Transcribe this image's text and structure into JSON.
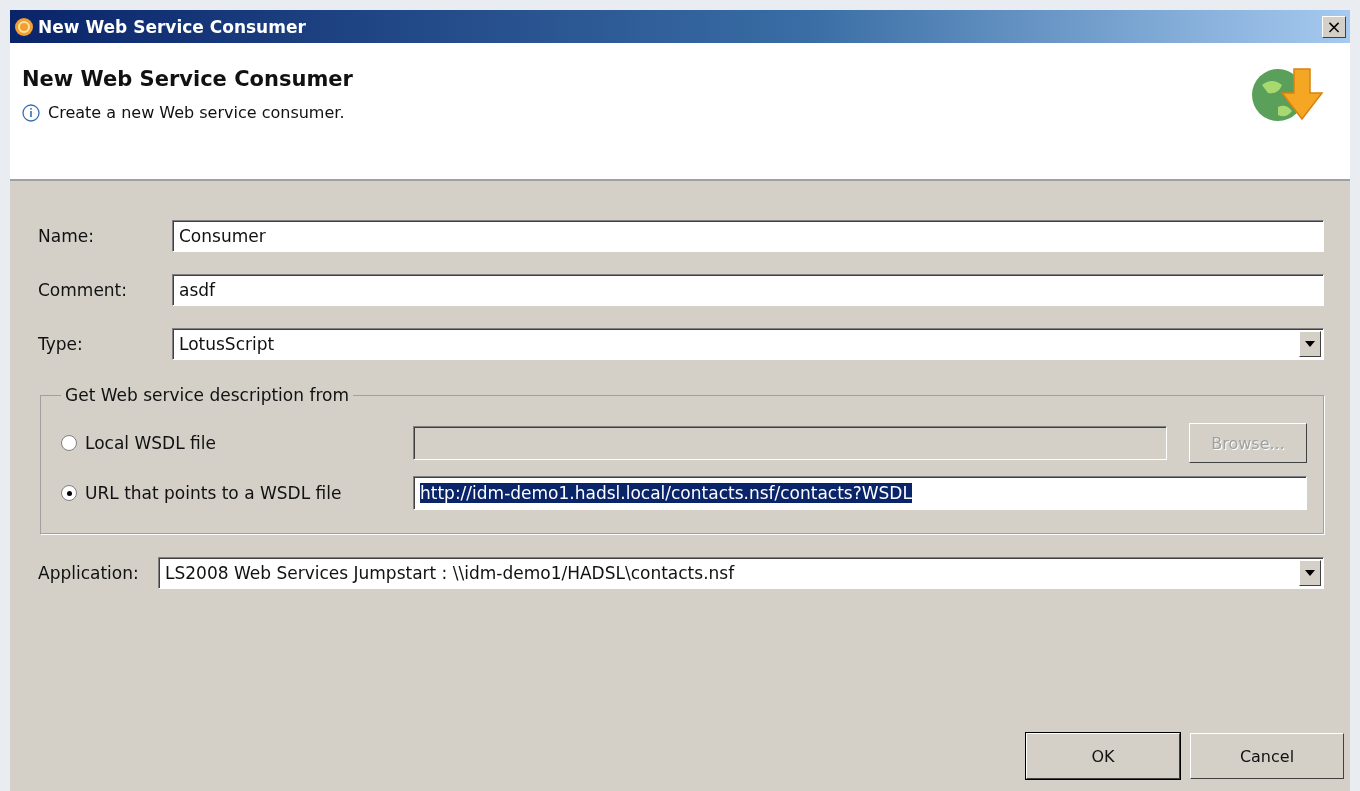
{
  "window": {
    "title": "New Web Service Consumer",
    "close": "×"
  },
  "header": {
    "title": "New Web Service Consumer",
    "message": "Create a new Web service consumer."
  },
  "fields": [
    {
      "label": "Name:",
      "kind": "text",
      "value": "Consumer"
    },
    {
      "label": "Comment:",
      "kind": "text",
      "value": "asdf"
    },
    {
      "label": "Type:",
      "kind": "dropdown",
      "value": "LotusScript"
    }
  ],
  "source_group": {
    "title": "Get Web service description from",
    "options": [
      {
        "label": "Local WSDL file",
        "selected": false,
        "disabled": true,
        "button": "Browse..."
      },
      {
        "label": "URL that points to a WSDL file",
        "selected": true,
        "value": "http://idm-demo1.hadsl.local/contacts.nsf/contacts?WSDL",
        "disabled": false,
        "text_selected": true
      }
    ]
  },
  "application": {
    "label": "Application:",
    "value": "LS2008 Web Services Jumpstart : \\\\idm-demo1/HADSL\\contacts.nsf"
  },
  "buttons": [
    {
      "label": "OK",
      "default": true
    },
    {
      "label": "Cancel",
      "default": false
    }
  ]
}
